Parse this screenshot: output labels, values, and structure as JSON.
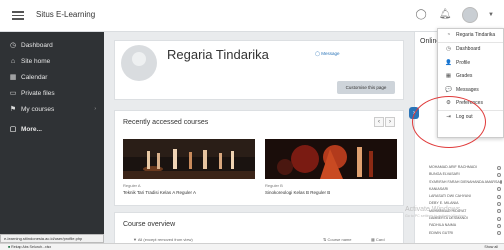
{
  "topbar": {
    "site_name": "Situs E-Learning"
  },
  "sidebar": {
    "items": [
      {
        "icon": "dashboard-icon",
        "glyph": "◷",
        "label": "Dashboard"
      },
      {
        "icon": "home-icon",
        "glyph": "⌂",
        "label": "Site home"
      },
      {
        "icon": "calendar-icon",
        "glyph": "▦",
        "label": "Calendar"
      },
      {
        "icon": "file-icon",
        "glyph": "▭",
        "label": "Private files"
      },
      {
        "icon": "courses-icon",
        "glyph": "⚑",
        "label": "My courses",
        "chevron": "›"
      },
      {
        "icon": "more-icon",
        "glyph": "▢",
        "label": "More..."
      }
    ],
    "status_url": "e-learning.stiindonesia.ac.id/user/profile.php"
  },
  "profile": {
    "name": "Regaria Tindarika",
    "message": "Message",
    "customise": "Customise this page"
  },
  "recent": {
    "title": "Recently accessed courses",
    "prev": "‹",
    "next": "›",
    "courses": [
      {
        "category": "Reguler A",
        "title": "Teknik Tari Tradisi Kelas A Reguler A"
      },
      {
        "category": "Reguler B",
        "title": "Sinokoreologi Kelas B Reguler B"
      }
    ]
  },
  "overview": {
    "title": "Course overview",
    "filter": "All (except removed from view)",
    "sort": "Course name",
    "view": "Card"
  },
  "online": {
    "title": "Online users",
    "users": [
      "MOHAMAD ARIF RACHMADI",
      "BUNGA ELVASARI",
      "SYARIFAH FARAH DIENAHANDA AMARSA",
      "KANIASARI",
      "LARASATI DWI CAHYANI",
      "DEBY E. MILANIA",
      "MUHAMMAD HIDAYAT",
      "LAMBERTA DESMANDI",
      "FADHILA NAIMA",
      "EDWIN GUTRI"
    ]
  },
  "dropdown": {
    "header": "Regaria Tindarika",
    "items": [
      {
        "icon": "dashboard-icon",
        "glyph": "◷",
        "label": "Dashboard"
      },
      {
        "icon": "user-icon",
        "glyph": "👤",
        "label": "Profile"
      },
      {
        "icon": "grades-icon",
        "glyph": "▦",
        "label": "Grades"
      },
      {
        "icon": "messages-icon",
        "glyph": "💬",
        "label": "Messages"
      },
      {
        "icon": "preferences-icon",
        "glyph": "⚙",
        "label": "Preferences"
      },
      {
        "icon": "logout-icon",
        "glyph": "⇥",
        "label": "Log out"
      }
    ]
  },
  "taskbar": {
    "download": "Rekap Abs Seluruh...xlsx",
    "show_all": "Show all"
  },
  "watermark": {
    "title": "Activate Windows",
    "subtitle": "Go to PC settings to activate Windows."
  },
  "colors": {
    "sidebar": "#2f3235",
    "accent": "#2a74b8",
    "highlight": "#e03a3a"
  }
}
